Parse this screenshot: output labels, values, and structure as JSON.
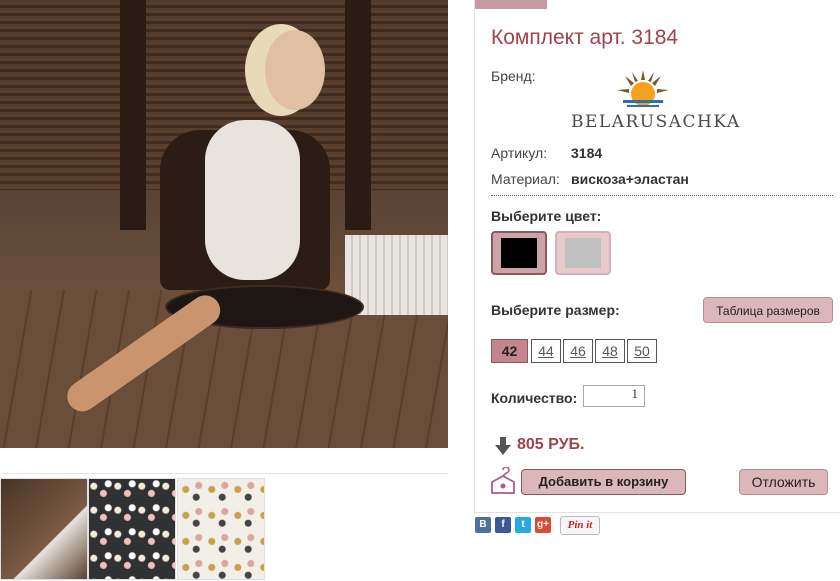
{
  "product": {
    "title": "Комплект арт. 3184",
    "brand_label": "Бренд:",
    "brand_logo_text": "BELARUSACHKA",
    "article_label": "Артикул:",
    "article_value": "3184",
    "material_label": "Материал:",
    "material_value": "вискоза+эластан"
  },
  "color": {
    "label": "Выберите цвет:",
    "options": [
      {
        "name": "black",
        "hex": "#000000",
        "selected": true
      },
      {
        "name": "gray",
        "hex": "#c0c0c0",
        "selected": false
      }
    ]
  },
  "size": {
    "label": "Выберите размер:",
    "table_button": "Таблица размеров",
    "options": [
      "42",
      "44",
      "46",
      "48",
      "50"
    ],
    "selected": "42"
  },
  "quantity": {
    "label": "Количество:",
    "value": "1"
  },
  "price": {
    "text": "805 РУБ.",
    "arrow_icon": "arrow-down-icon"
  },
  "actions": {
    "add_to_cart": "Добавить в корзину",
    "later": "Отложить"
  },
  "social": {
    "vk": "В",
    "fb": "f",
    "tw": "t",
    "gp": "g+",
    "pinit": "Pin it"
  },
  "colors": {
    "accent": "#a0434b",
    "button_bg": "#dbb6ba",
    "active_size": "#c2868c"
  }
}
